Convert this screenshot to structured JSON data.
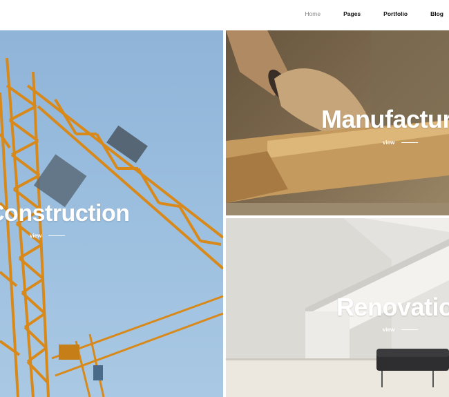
{
  "nav": {
    "items": [
      {
        "label": "Home",
        "active": true
      },
      {
        "label": "Pages",
        "active": false
      },
      {
        "label": "Portfolio",
        "active": false
      },
      {
        "label": "Blog",
        "active": false
      }
    ]
  },
  "tiles": [
    {
      "title": "Construction",
      "link": "view"
    },
    {
      "title": "Manufacturing",
      "link": "view"
    },
    {
      "title": "Renovation",
      "link": "view"
    }
  ],
  "colors": {
    "nav_active": "#8a8a8a",
    "nav_text": "#111111",
    "crane": "#e29a1c",
    "sky": "#9dc0e0",
    "wood": "#c8a26a",
    "wall": "#e6e4e0"
  }
}
